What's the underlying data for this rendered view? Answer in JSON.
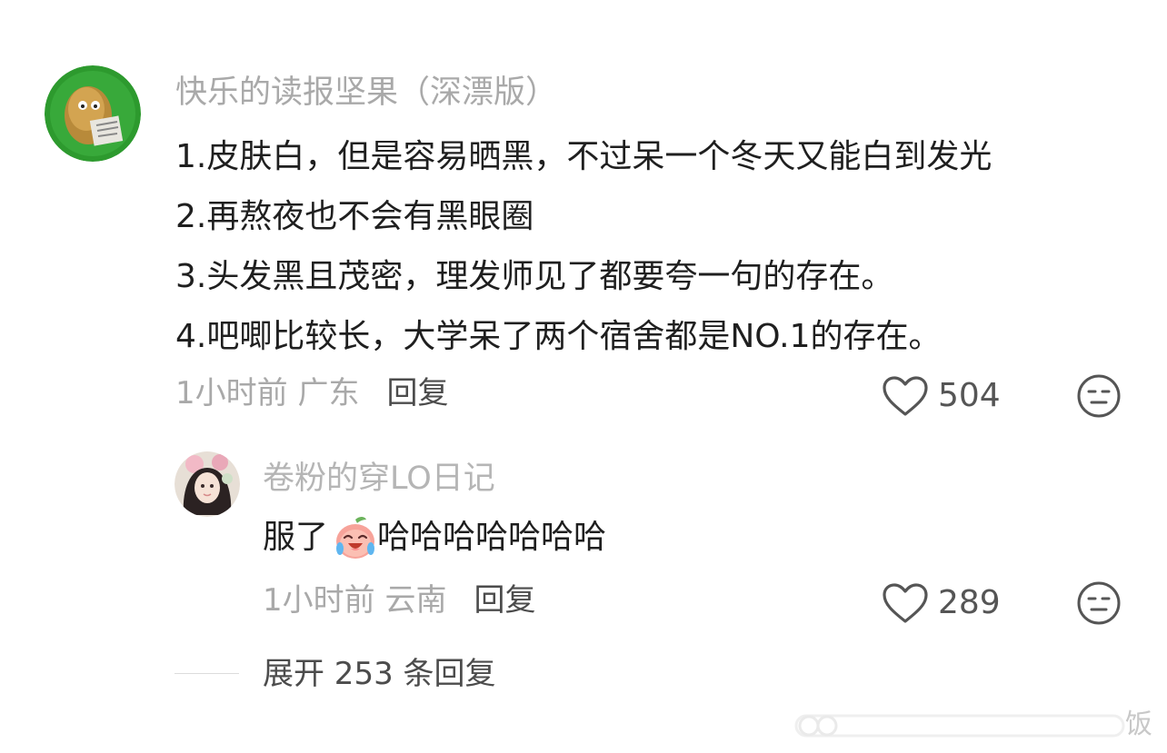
{
  "main_comment": {
    "username": "快乐的读报坚果（深漂版）",
    "lines": [
      "1.皮肤白，但是容易晒黑，不过呆一个冬天又能白到发光",
      "2.再熬夜也不会有黑眼圈",
      "3.头发黑且茂密，理发师见了都要夸一句的存在。",
      "4.吧唧比较长，大学呆了两个宿舍都是NO.1的存在。"
    ],
    "time_location": "1小时前 广东",
    "reply_label": "回复",
    "like_count": "504",
    "like_icon": "heart-outline-icon",
    "dislike_icon": "neutral-face-icon"
  },
  "reply_comment": {
    "username": "卷粉的穿LO日记",
    "text_before": "服了",
    "emoji": "laughing-crying-peach-emoji",
    "text_after": "哈哈哈哈哈哈哈",
    "time_location": "1小时前 云南",
    "reply_label": "回复",
    "like_count": "289"
  },
  "expand": {
    "label": "展开 253 条回复"
  },
  "watermark": {
    "text": "饭"
  },
  "colors": {
    "avatar_green": "#2d9a2e",
    "muted_text": "#a9a9a9",
    "body_text": "#1f1f1f"
  }
}
